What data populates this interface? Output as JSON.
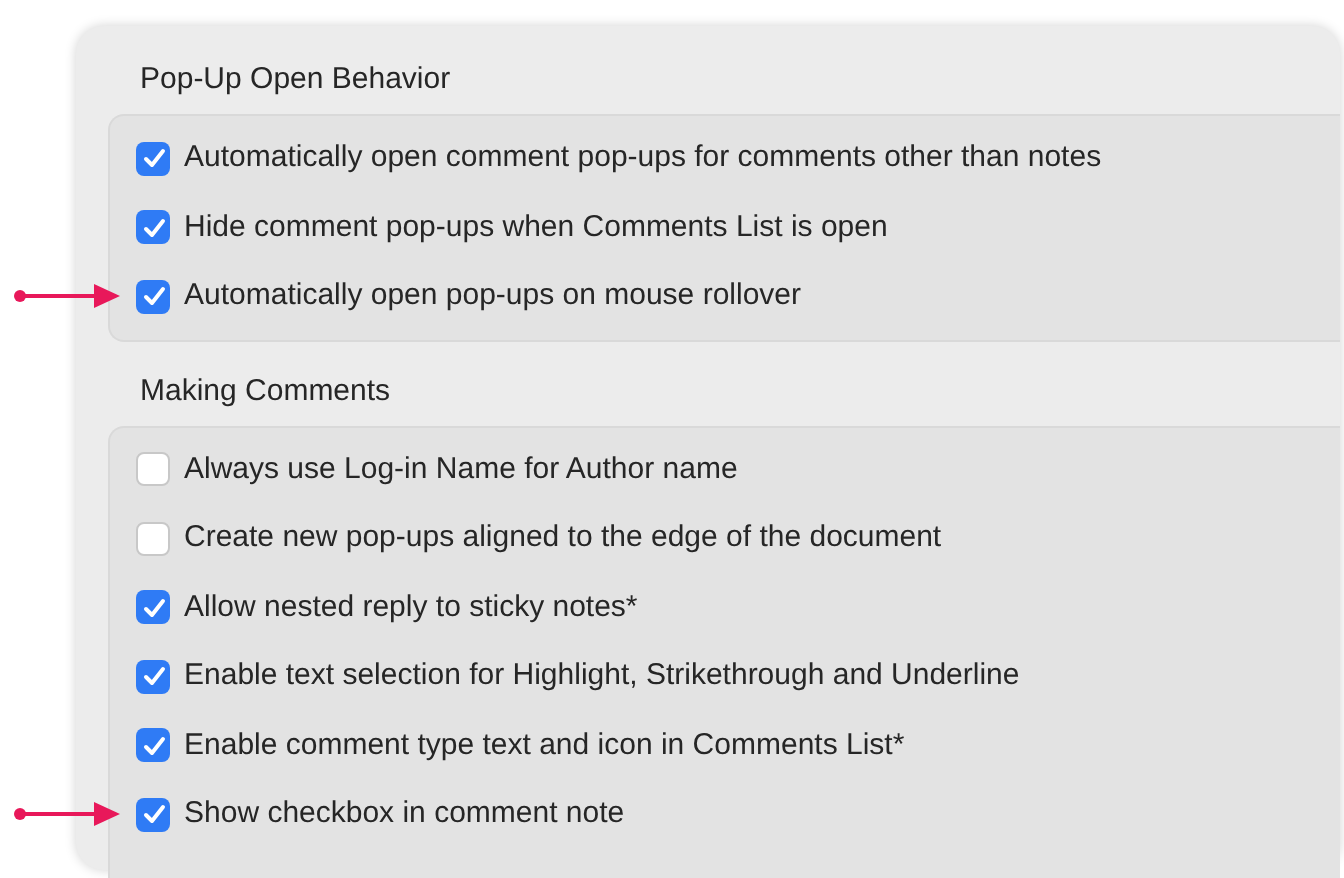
{
  "sections": [
    {
      "heading": "Pop-Up Open Behavior",
      "options": [
        {
          "label": "Automatically open comment pop-ups for comments other than notes",
          "checked": true,
          "pointer": false
        },
        {
          "label": "Hide comment pop-ups when Comments List is open",
          "checked": true,
          "pointer": false
        },
        {
          "label": "Automatically open pop-ups on mouse rollover",
          "checked": true,
          "pointer": true
        }
      ]
    },
    {
      "heading": "Making Comments",
      "options": [
        {
          "label": "Always use Log-in Name for Author name",
          "checked": false,
          "pointer": false
        },
        {
          "label": "Create new pop-ups aligned to the edge of the document",
          "checked": false,
          "pointer": false
        },
        {
          "label": "Allow nested reply to sticky notes*",
          "checked": true,
          "pointer": false
        },
        {
          "label": "Enable text selection for Highlight, Strikethrough and Underline",
          "checked": true,
          "pointer": false
        },
        {
          "label": "Enable comment type text and icon in Comments List*",
          "checked": true,
          "pointer": false
        },
        {
          "label": "Show checkbox in comment note",
          "checked": true,
          "pointer": true
        }
      ]
    }
  ]
}
